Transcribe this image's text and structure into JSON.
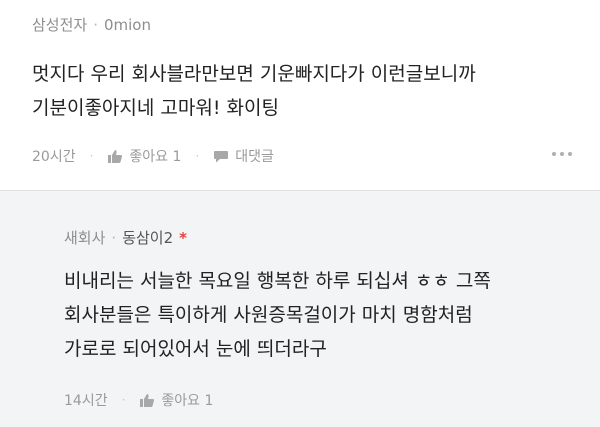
{
  "comment": {
    "company": "삼성전자",
    "author": "0mion",
    "lines": [
      "멋지다 우리 회사블라만보면 기운빠지다가 이런글보니까",
      "기분이좋아지네 고마워! 화이팅"
    ],
    "time": "20시간",
    "like_label": "좋아요 1",
    "reply_label": "대댓글"
  },
  "reply": {
    "company": "새회사",
    "author": "동삼이2",
    "author_mark": "*",
    "lines": [
      "비내리는 서늘한 목요일 행복한 하루 되십셔 ㅎㅎ 그쪽",
      "회사분들은 특이하게 사원증목걸이가 마치 명함처럼",
      "가로로 되어있어서 눈에 띄더라구"
    ],
    "time": "14시간",
    "like_label": "좋아요 1"
  },
  "colors": {
    "accent_star": "#e8413e",
    "reply_bg": "#f3f4f6",
    "meta": "#8e8e8e"
  },
  "icons": {
    "like": "thumbs-up-icon",
    "reply": "speech-bubble-icon",
    "more": "more-dots-icon"
  }
}
